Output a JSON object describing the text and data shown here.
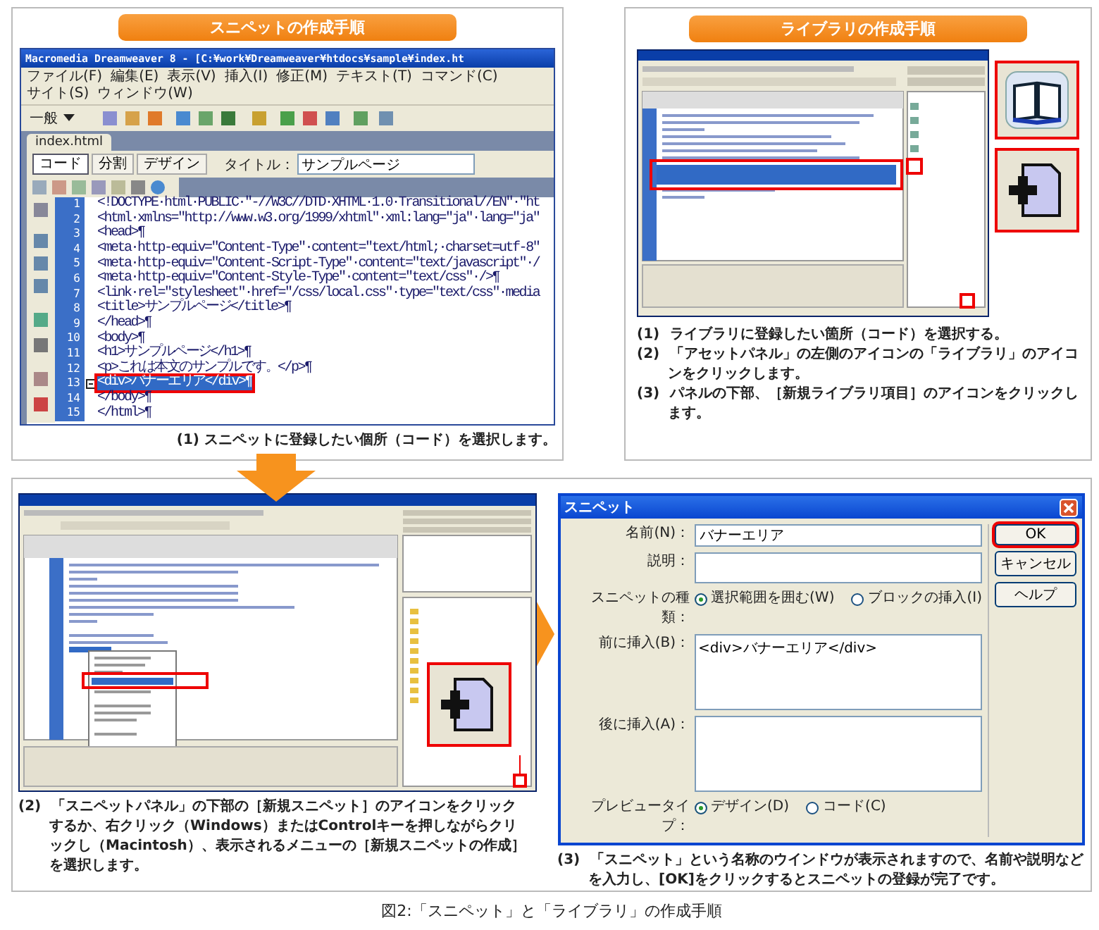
{
  "snippet_section": {
    "heading": "スニペットの作成手順",
    "editor": {
      "title": "Macromedia Dreamweaver 8 - [C:¥work¥Dreamweaver¥htdocs¥sample¥index.ht",
      "menu": [
        "ファイル(F)",
        "編集(E)",
        "表示(V)",
        "挿入(I)",
        "修正(M)",
        "テキスト(T)",
        "コマンド(C)",
        "サイト(S)",
        "ウィンドウ(W)"
      ],
      "insert_category": "一般",
      "document_tab": "index.html",
      "view_buttons": [
        {
          "label": "コード",
          "selected": true
        },
        {
          "label": "分割",
          "selected": false
        },
        {
          "label": "デザイン",
          "selected": false
        }
      ],
      "title_label": "タイトル：",
      "title_value": "サンプルページ",
      "code_lines": [
        {
          "number": "1",
          "text": "<!DOCTYPE·html·PUBLIC·\"-//W3C//DTD·XHTML·1.0·Transitional//EN\"·\"ht",
          "selected": false
        },
        {
          "number": "2",
          "text": "<html·xmlns=\"http://www.w3.org/1999/xhtml\"·xml:lang=\"ja\"·lang=\"ja\"",
          "selected": false
        },
        {
          "number": "3",
          "text": "<head>¶",
          "selected": false
        },
        {
          "number": "4",
          "text": "<meta·http-equiv=\"Content-Type\"·content=\"text/html;·charset=utf-8\"",
          "selected": false
        },
        {
          "number": "5",
          "text": "<meta·http-equiv=\"Content-Script-Type\"·content=\"text/javascript\"·/",
          "selected": false
        },
        {
          "number": "6",
          "text": "<meta·http-equiv=\"Content-Style-Type\"·content=\"text/css\"·/>¶",
          "selected": false
        },
        {
          "number": "7",
          "text": "<link·rel=\"stylesheet\"·href=\"/css/local.css\"·type=\"text/css\"·media",
          "selected": false
        },
        {
          "number": "8",
          "text": "<title>サンプルページ</title>¶",
          "selected": false
        },
        {
          "number": "9",
          "text": "</head>¶",
          "selected": false
        },
        {
          "number": "10",
          "text": "<body>¶",
          "selected": false
        },
        {
          "number": "11",
          "text": "<h1>サンプルページ</h1>¶",
          "selected": false
        },
        {
          "number": "12",
          "text": "<p>これは本文のサンプルです。</p>¶",
          "selected": false
        },
        {
          "number": "13",
          "text": "<div>バナーエリア</div>¶",
          "selected": true
        },
        {
          "number": "14",
          "text": "</body>¶",
          "selected": false
        },
        {
          "number": "15",
          "text": "</html>¶",
          "selected": false
        }
      ]
    },
    "caption": {
      "number": "(1)",
      "text": "スニペットに登録したい個所（コード）を選択します。"
    }
  },
  "library_section": {
    "heading": "ライブラリの作成手順",
    "steps": [
      {
        "number": "(1)",
        "text": "ライブラリに登録したい箇所（コード）を選択する。"
      },
      {
        "number": "(2)",
        "text": "「アセットパネル」の左側のアイコンの「ライブラリ」のアイコンをクリックします。"
      },
      {
        "number": "(3)",
        "text": "パネルの下部、［新規ライブラリ項目］のアイコンをクリックします。"
      }
    ]
  },
  "snippet_steps": {
    "step2": {
      "number": "(2)",
      "text": "「スニペットパネル」の下部の［新規スニペット］のアイコンをクリックするか、右クリック（Windows）またはControlキーを押しながらクリックし（Macintosh）、表示されるメニューの［新規スニペットの作成］を選択します。"
    },
    "dialog": {
      "title": "スニペット",
      "fields": [
        {
          "label": "名前(N)：",
          "kind": "input",
          "value": "バナーエリア"
        },
        {
          "label": "説明：",
          "kind": "note"
        },
        {
          "label": "スニペットの種類：",
          "kind": "radio",
          "options": [
            {
              "label": "選択範囲を囲む(W)",
              "selected": true
            },
            {
              "label": "ブロックの挿入(I)",
              "selected": false
            }
          ]
        },
        {
          "label": "前に挿入(B)：",
          "kind": "textarea",
          "value": "<div>バナーエリア</div>"
        },
        {
          "label": "後に挿入(A)：",
          "kind": "textarea"
        },
        {
          "label": "プレビュータイプ：",
          "kind": "radio",
          "options": [
            {
              "label": "デザイン(D)",
              "selected": true
            },
            {
              "label": "コード(C)",
              "selected": false
            }
          ]
        }
      ],
      "buttons": [
        {
          "label": "OK",
          "callout": true
        },
        {
          "label": "キャンセル",
          "callout": false
        },
        {
          "label": "ヘルプ",
          "callout": false
        }
      ]
    },
    "step3": {
      "number": "(3)",
      "text": "「スニペット」という名称のウインドウが表示されますので、名前や説明などを入力し、[OK]をクリックするとスニペットの登録が完了です。"
    }
  },
  "figure_caption": "図2:「スニペット」と「ライブラリ」の作成手順"
}
